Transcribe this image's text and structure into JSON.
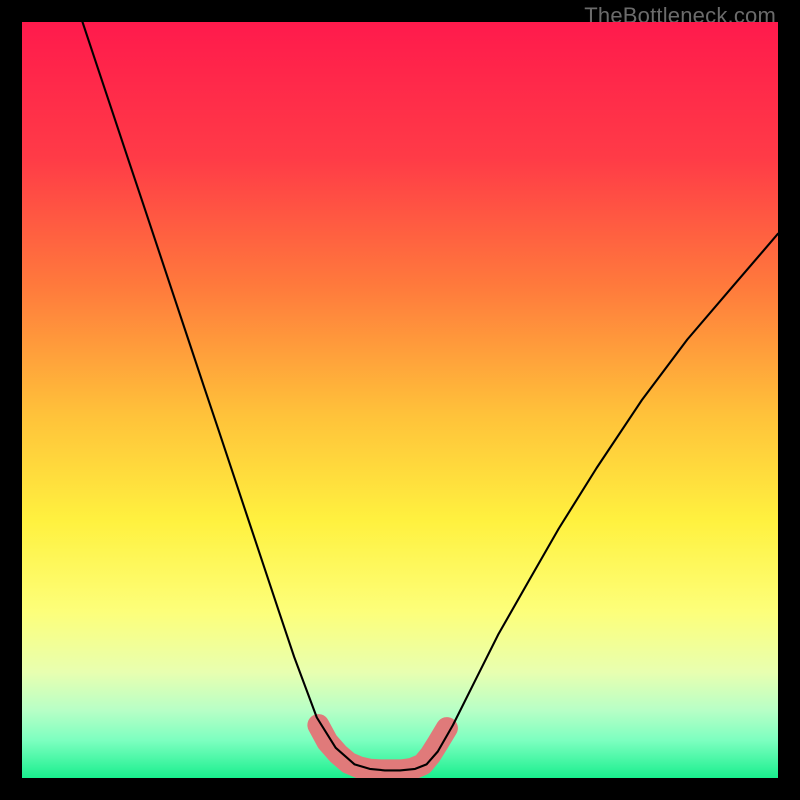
{
  "watermark": "TheBottleneck.com",
  "chart_data": {
    "type": "line",
    "title": "",
    "xlabel": "",
    "ylabel": "",
    "xlim": [
      0,
      100
    ],
    "ylim": [
      0,
      100
    ],
    "gradient_stops": [
      {
        "offset": 0,
        "color": "#ff1a4c"
      },
      {
        "offset": 18,
        "color": "#ff3b47"
      },
      {
        "offset": 35,
        "color": "#ff7a3c"
      },
      {
        "offset": 52,
        "color": "#ffc23a"
      },
      {
        "offset": 66,
        "color": "#fff13f"
      },
      {
        "offset": 78,
        "color": "#fdff7a"
      },
      {
        "offset": 86,
        "color": "#e8ffb0"
      },
      {
        "offset": 91,
        "color": "#b8ffc6"
      },
      {
        "offset": 95,
        "color": "#7dffc0"
      },
      {
        "offset": 100,
        "color": "#19ef8e"
      }
    ],
    "series": [
      {
        "name": "bottleneck-curve",
        "color": "#000000",
        "stroke_width": 2.1,
        "x": [
          8,
          10,
          12,
          14,
          16,
          18,
          20,
          22,
          24,
          26,
          28,
          30,
          32,
          34,
          36,
          37.5,
          39,
          41.5,
          44,
          46,
          48,
          50,
          52,
          53.5,
          55,
          57,
          60,
          63,
          67,
          71,
          76,
          82,
          88,
          94,
          100
        ],
        "y": [
          100,
          94,
          88,
          82,
          76,
          70,
          64,
          58,
          52,
          46,
          40,
          34,
          28,
          22,
          16,
          12,
          8,
          4,
          1.8,
          1.2,
          1.0,
          1.0,
          1.2,
          1.8,
          3.5,
          7,
          13,
          19,
          26,
          33,
          41,
          50,
          58,
          65,
          72
        ]
      }
    ],
    "highlight_band": {
      "name": "optimal-zone",
      "color": "#e07a7a",
      "points": [
        {
          "x": 39.2,
          "y": 7.0,
          "r": 6
        },
        {
          "x": 40.4,
          "y": 4.8,
          "r": 6
        },
        {
          "x": 41.8,
          "y": 3.2,
          "r": 6
        },
        {
          "x": 43.2,
          "y": 2.0,
          "r": 6
        },
        {
          "x": 44.6,
          "y": 1.4,
          "r": 6
        },
        {
          "x": 46.0,
          "y": 1.1,
          "r": 6
        },
        {
          "x": 47.4,
          "y": 1.0,
          "r": 6
        },
        {
          "x": 48.8,
          "y": 1.0,
          "r": 6
        },
        {
          "x": 50.2,
          "y": 1.0,
          "r": 6
        },
        {
          "x": 51.6,
          "y": 1.2,
          "r": 6
        },
        {
          "x": 53.0,
          "y": 1.8,
          "r": 6
        },
        {
          "x": 54.0,
          "y": 3.0,
          "r": 6
        },
        {
          "x": 55.0,
          "y": 4.6,
          "r": 5
        },
        {
          "x": 56.2,
          "y": 6.6,
          "r": 5
        }
      ]
    }
  }
}
